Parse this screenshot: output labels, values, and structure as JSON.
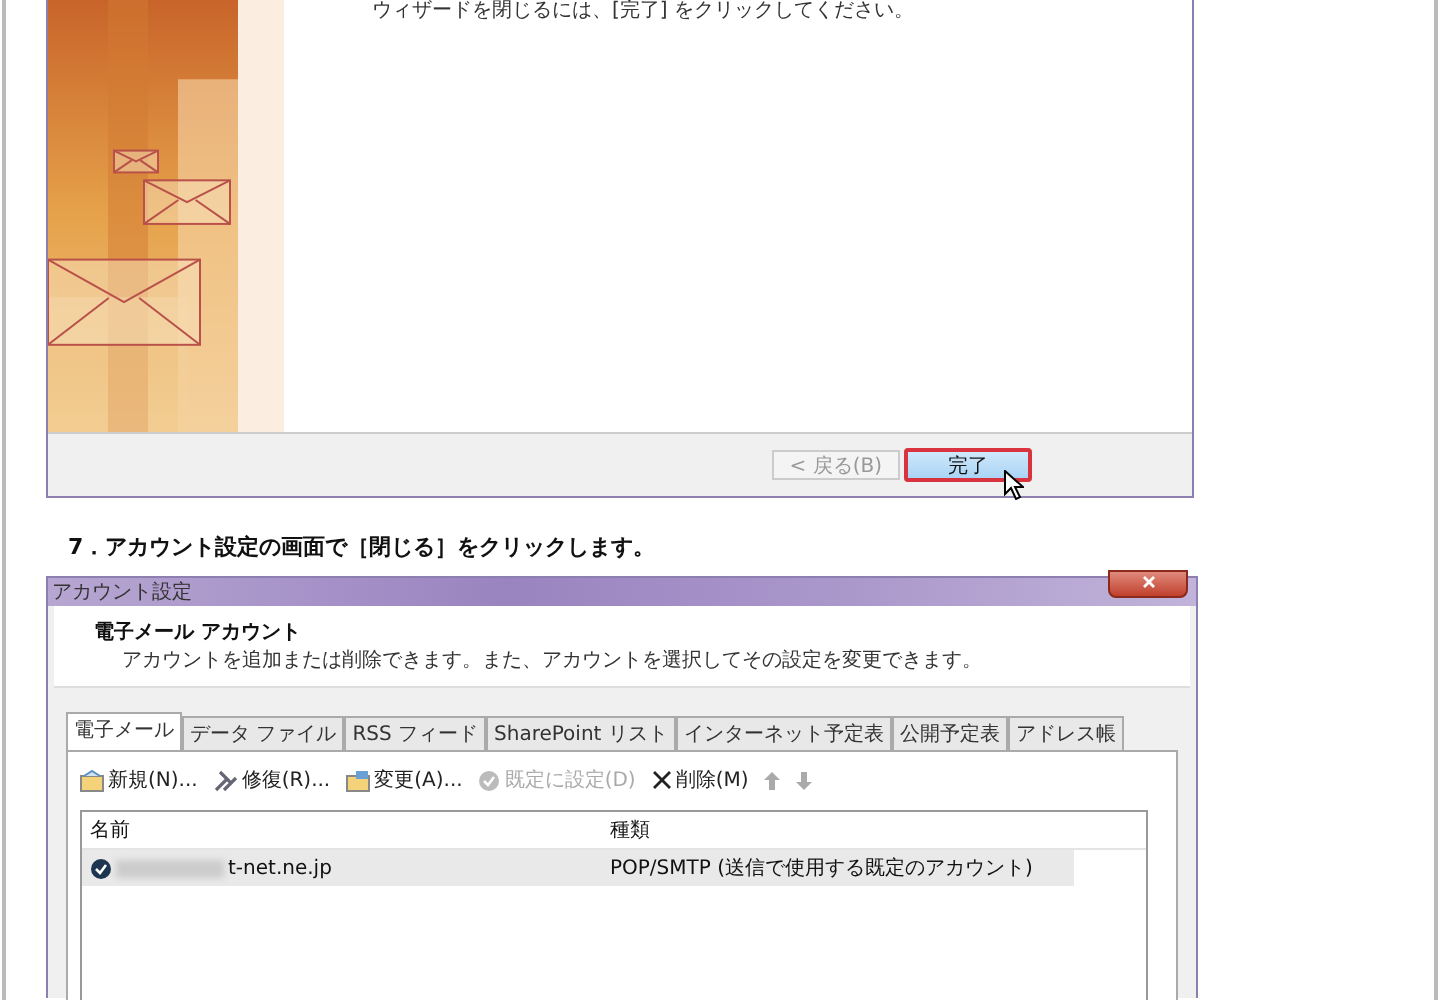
{
  "wizard": {
    "message": "ウィザードを閉じるには、[完了] をクリックしてください。",
    "buttons": [
      {
        "label": "< 戻る(B)",
        "disabled": true,
        "highlighted": false
      },
      {
        "label": "完了",
        "disabled": false,
        "highlighted": true
      }
    ]
  },
  "step": {
    "text": "7．アカウント設定の画面で［閉じる］をクリックします。"
  },
  "account_dialog": {
    "title": "アカウント設定",
    "header": {
      "title": "電子メール アカウント",
      "description": "アカウントを追加または削除できます。また、アカウントを選択してその設定を変更できます。"
    },
    "tabs": [
      {
        "label": "電子メール",
        "selected": true
      },
      {
        "label": "データ ファイル",
        "selected": false
      },
      {
        "label": "RSS フィード",
        "selected": false
      },
      {
        "label": "SharePoint リスト",
        "selected": false
      },
      {
        "label": "インターネット予定表",
        "selected": false
      },
      {
        "label": "公開予定表",
        "selected": false
      },
      {
        "label": "アドレス帳",
        "selected": false
      }
    ],
    "toolbar": [
      {
        "kind": "new",
        "label": "新規(N)...",
        "disabled": false
      },
      {
        "kind": "repair",
        "label": "修復(R)...",
        "disabled": false
      },
      {
        "kind": "change",
        "label": "変更(A)...",
        "disabled": false
      },
      {
        "kind": "default",
        "label": "既定に設定(D)",
        "disabled": true
      },
      {
        "kind": "delete",
        "label": "削除(M)",
        "disabled": false
      },
      {
        "kind": "up",
        "disabled": true
      },
      {
        "kind": "down",
        "disabled": true
      }
    ],
    "list": {
      "columns": [
        "名前",
        "種類"
      ],
      "rows": [
        {
          "name": "t-net.ne.jp",
          "type": "POP/SMTP (送信で使用する既定のアカウント)",
          "default": true,
          "selected": true
        }
      ]
    }
  }
}
